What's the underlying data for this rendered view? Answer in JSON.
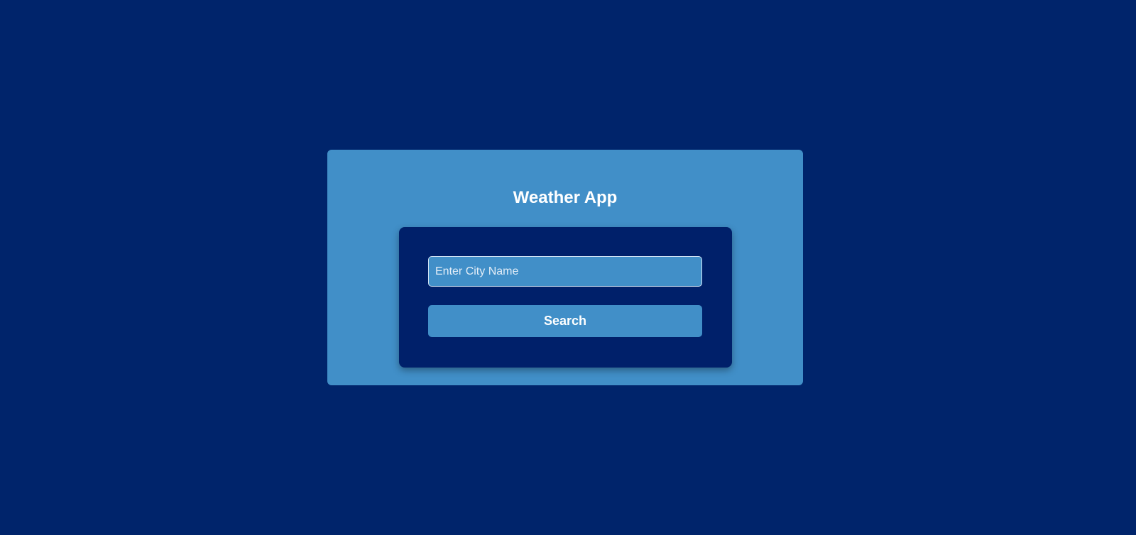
{
  "app": {
    "title": "Weather App"
  },
  "search": {
    "placeholder": "Enter City Name",
    "value": "",
    "button_label": "Search"
  },
  "colors": {
    "background": "#00246b",
    "card": "#418fc8",
    "inner_panel": "#00206a",
    "text": "#ffffff"
  }
}
